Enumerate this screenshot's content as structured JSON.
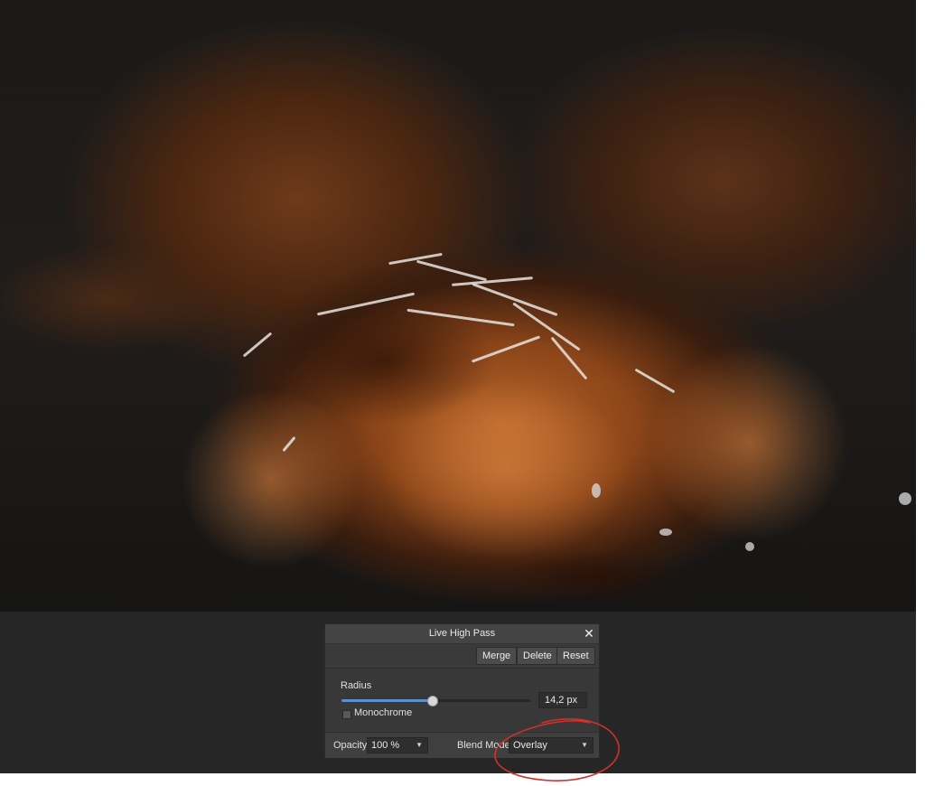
{
  "panel": {
    "title": "Live High Pass",
    "close_icon": "close-icon",
    "toolbar": {
      "merge_label": "Merge",
      "delete_label": "Delete",
      "reset_label": "Reset"
    },
    "radius": {
      "label": "Radius",
      "value_text": "14,2 px",
      "slider_fraction": 0.48
    },
    "monochrome": {
      "label": "Monochrome",
      "checked": false
    },
    "opacity": {
      "label": "Opacity:",
      "value": "100 %"
    },
    "blend_mode": {
      "label": "Blend Mode:",
      "value": "Overlay"
    }
  },
  "colors": {
    "accent": "#5d8fce",
    "annotation": "#d0312d"
  }
}
